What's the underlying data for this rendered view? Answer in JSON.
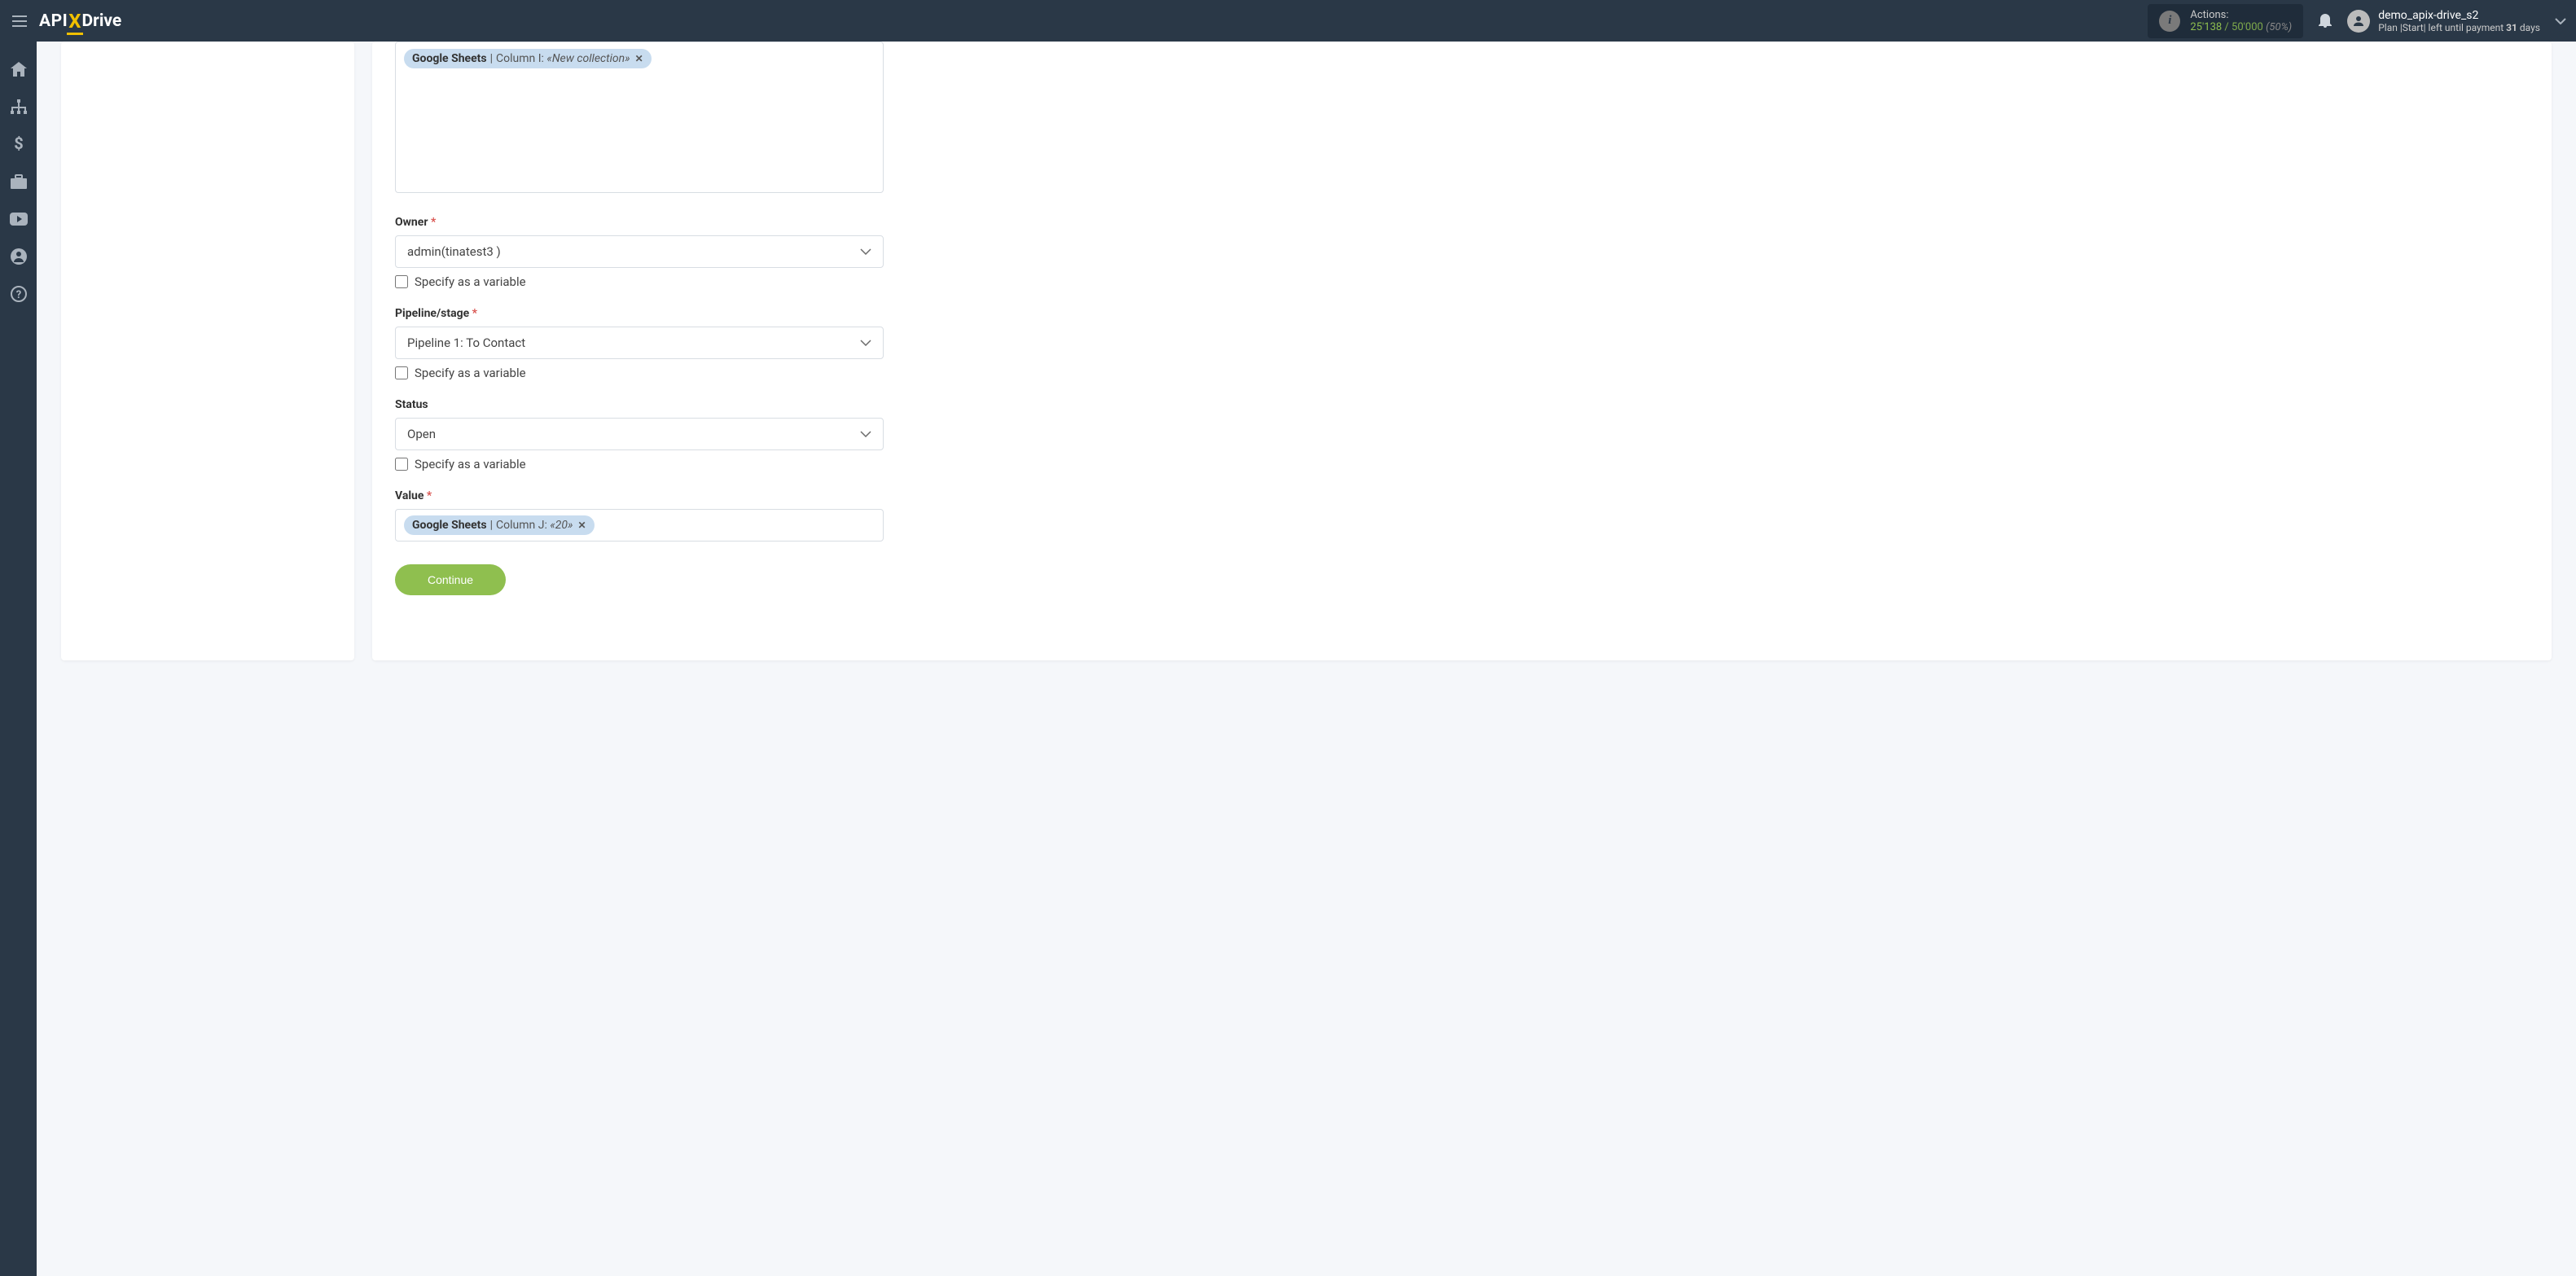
{
  "header": {
    "brand_api": "API",
    "brand_x": "X",
    "brand_drive": "Drive",
    "actions_label": "Actions:",
    "actions_used": "25'138",
    "actions_slash": " / ",
    "actions_total": "50'000",
    "actions_pct": "(50%)",
    "user_name": "demo_apix-drive_s2",
    "plan_prefix": "Plan |",
    "plan_name": "Start",
    "plan_mid": "| left until payment ",
    "plan_days": "31",
    "plan_days_suffix": " days"
  },
  "form": {
    "chip1": {
      "source": "Google Sheets",
      "column_label": "Column I:",
      "value": "«New collection»"
    },
    "owner": {
      "label": "Owner",
      "value": "admin(tinatest3 )",
      "specify": "Specify as a variable"
    },
    "pipeline": {
      "label": "Pipeline/stage",
      "value": "Pipeline 1: To Contact",
      "specify": "Specify as a variable"
    },
    "status": {
      "label": "Status",
      "value": "Open",
      "specify": "Specify as a variable"
    },
    "amount": {
      "label": "Value",
      "chip": {
        "source": "Google Sheets",
        "column_label": "Column J:",
        "value": "«20»"
      }
    },
    "continue": "Continue"
  }
}
